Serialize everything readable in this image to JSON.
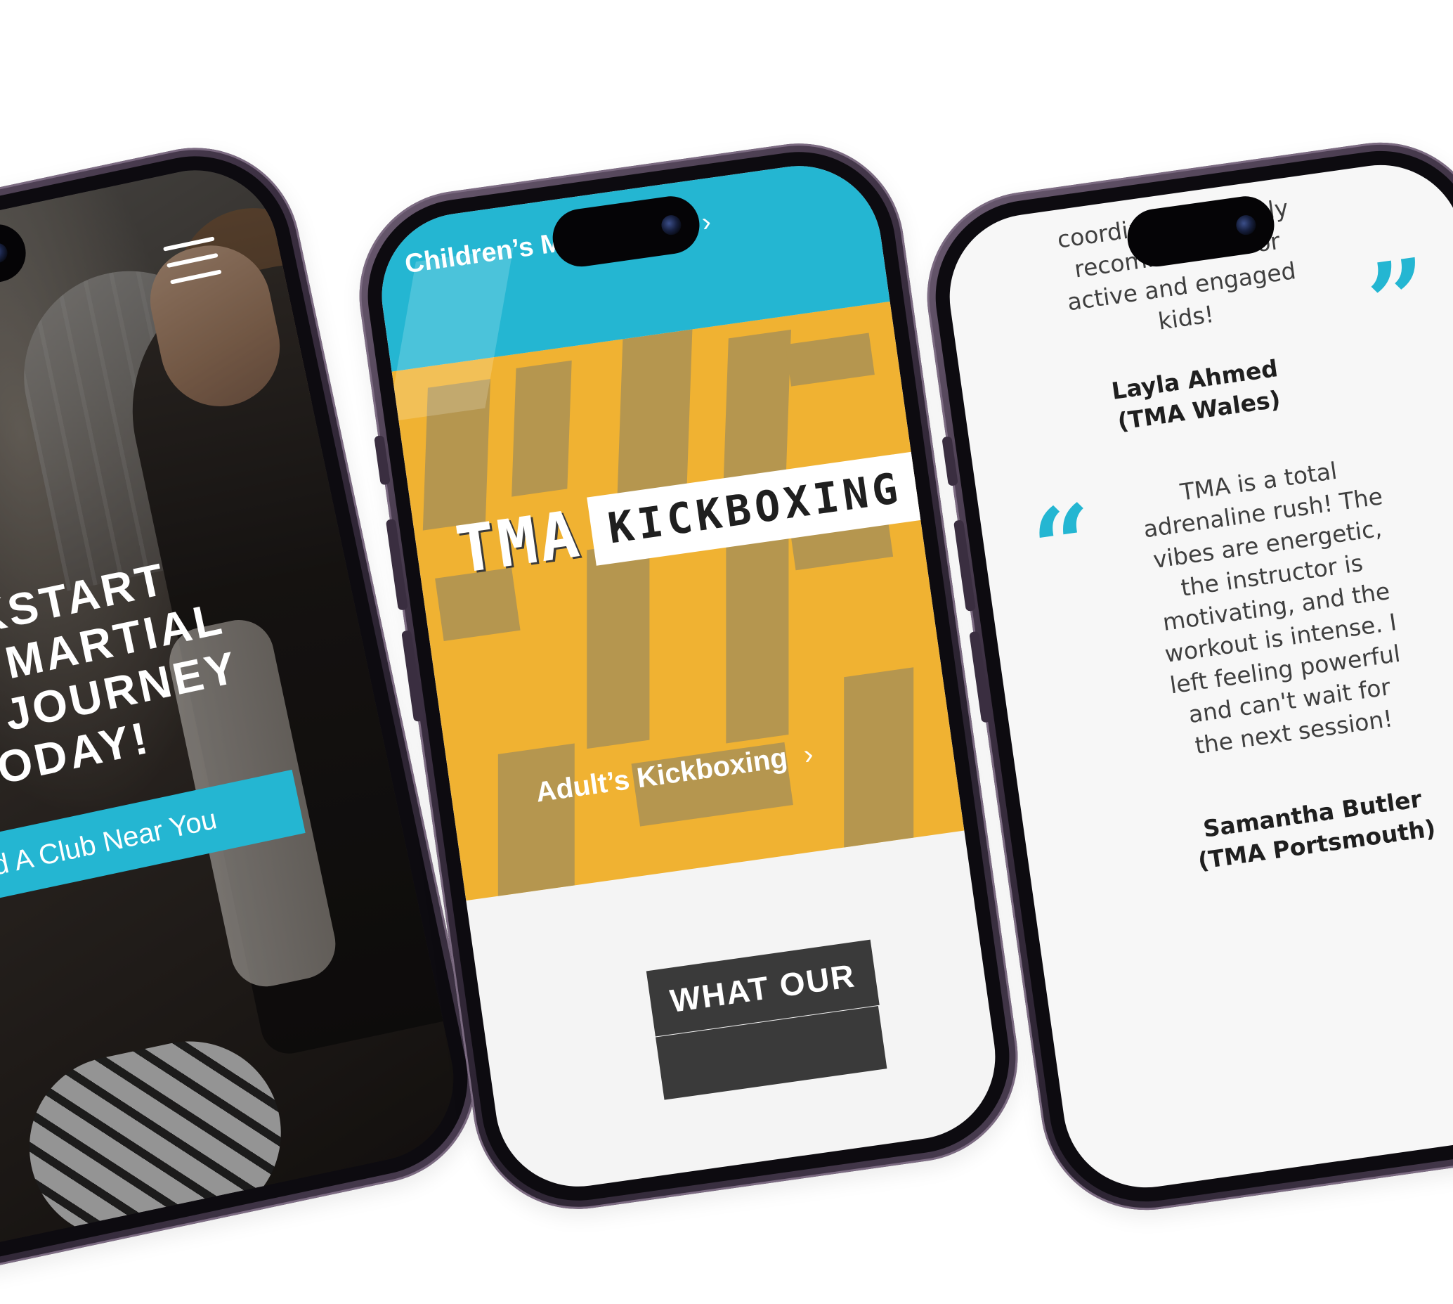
{
  "phone_left": {
    "headline_lines": [
      "KICKSTART",
      "YOUR MARTIAL",
      "ARTS JOURNEY",
      "TODAY!"
    ],
    "cta_label": "Find A Club Near You",
    "menu_icon": "hamburger-menu-icon"
  },
  "phone_center": {
    "top_link_label": "Children’s Martial Arts",
    "logo_prefix": "TMA",
    "logo_word": "KICKBOXING",
    "hero_link_label": "Adult’s Kickboxing",
    "section_heading": "WHAT OUR",
    "chevron_icon": "chevron-right-icon",
    "colors": {
      "accent_blue": "#24b6d2",
      "hero_yellow": "#f0b232",
      "heading_bg": "#3a3a3a"
    }
  },
  "phone_right": {
    "testimonial_1": {
      "text_lines": [
        "coordination. Highly",
        "recommended for",
        "active and engaged",
        "kids!"
      ],
      "name": "Layla Ahmed",
      "club": "(TMA Wales)"
    },
    "testimonial_2": {
      "text_lines": [
        "TMA is a total",
        "adrenaline rush! The",
        "vibes are energetic,",
        "the instructor is",
        "motivating, and the",
        "workout is intense. I",
        "left feeling powerful",
        "and can't wait for",
        "the next session!"
      ],
      "name": "Samantha Butler",
      "club": "(TMA Portsmouth)"
    },
    "quote_open_icon": "quote-open-icon",
    "quote_close_icon": "quote-close-icon"
  }
}
